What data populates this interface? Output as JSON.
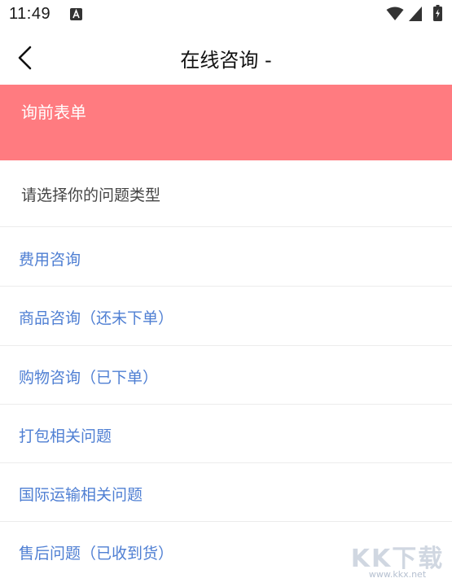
{
  "status_bar": {
    "time": "11:49",
    "icons": [
      "a-notification-icon",
      "wifi-icon",
      "signal-icon",
      "battery-charging-icon"
    ]
  },
  "app_bar": {
    "title": "在线咨询 -",
    "back_icon": "chevron-left-icon"
  },
  "form": {
    "header_title": "询前表单",
    "prompt": "请选择你的问题类型",
    "options": [
      {
        "label": "费用咨询"
      },
      {
        "label": "商品咨询（还未下单）"
      },
      {
        "label": "购物咨询（已下单）"
      },
      {
        "label": "打包相关问题"
      },
      {
        "label": "国际运输相关问题"
      },
      {
        "label": "售后问题（已收到货）"
      }
    ]
  },
  "watermark": {
    "brand": "KK下载",
    "url": "www.kkx.net"
  },
  "colors": {
    "header_bg": "#ff7b80",
    "option_text": "#4f7fd3",
    "divider": "#ececec"
  }
}
